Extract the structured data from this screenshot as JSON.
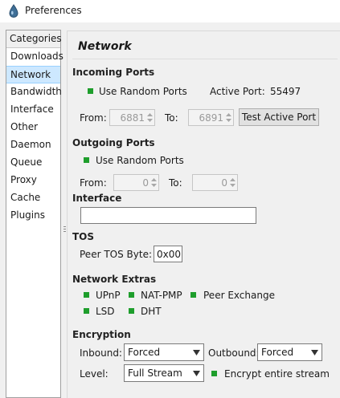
{
  "window": {
    "title": "Preferences",
    "app_icon": "droplet-icon"
  },
  "categories": {
    "header": "Categories",
    "items": [
      "Downloads",
      "Network",
      "Bandwidth",
      "Interface",
      "Other",
      "Daemon",
      "Queue",
      "Proxy",
      "Cache",
      "Plugins"
    ],
    "selected": "Network"
  },
  "page": {
    "title": "Network"
  },
  "incoming_ports": {
    "title": "Incoming Ports",
    "use_random_label": "Use Random Ports",
    "use_random_checked": true,
    "active_port_label": "Active Port:",
    "active_port_value": "55497",
    "from_label": "From:",
    "from_value": "6881",
    "to_label": "To:",
    "to_value": "6891",
    "test_button": "Test Active Port"
  },
  "outgoing_ports": {
    "title": "Outgoing Ports",
    "use_random_label": "Use Random Ports",
    "use_random_checked": true,
    "from_label": "From:",
    "from_value": "0",
    "to_label": "To:",
    "to_value": "0"
  },
  "interface": {
    "title": "Interface",
    "value": ""
  },
  "tos": {
    "title": "TOS",
    "label": "Peer TOS Byte:",
    "value": "0x00"
  },
  "network_extras": {
    "title": "Network Extras",
    "upnp": "UPnP",
    "natpmp": "NAT-PMP",
    "peer_exchange": "Peer Exchange",
    "lsd": "LSD",
    "dht": "DHT"
  },
  "encryption": {
    "title": "Encryption",
    "inbound_label": "Inbound:",
    "inbound_value": "Forced",
    "outbound_label": "Outbound:",
    "outbound_value": "Forced",
    "level_label": "Level:",
    "level_value": "Full Stream",
    "encrypt_entire_label": "Encrypt entire stream",
    "encrypt_entire_checked": true
  },
  "colors": {
    "check": "#1e9e2c",
    "selection": "#cde8ff",
    "background": "#f0f0f0"
  }
}
